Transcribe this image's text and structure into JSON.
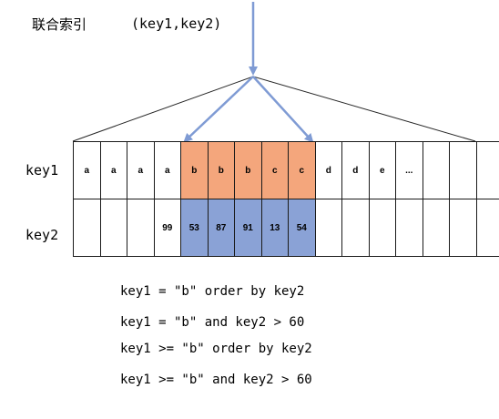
{
  "title": {
    "text": "联合索引",
    "columns": "(key1,key2)"
  },
  "rows": {
    "key1": {
      "label": "key1",
      "cells": [
        "a",
        "a",
        "a",
        "a",
        "b",
        "b",
        "b",
        "c",
        "c",
        "d",
        "d",
        "e",
        "...",
        "",
        "",
        ""
      ]
    },
    "key2": {
      "label": "key2",
      "cells": [
        "",
        "",
        "",
        "99",
        "53",
        "87",
        "91",
        "13",
        "54",
        "",
        "",
        "",
        "",
        "",
        "",
        ""
      ]
    }
  },
  "highlight": {
    "key1_color": "#f4a67c",
    "key2_color": "#8aa2d6",
    "arrow_color": "#7f9bd4",
    "columns": [
      4,
      5,
      6,
      7,
      8
    ]
  },
  "queries": [
    "key1 = \"b\" order by key2",
    "key1 = \"b\" and key2 > 60",
    "key1 >= \"b\" order by key2",
    "key1 >= \"b\" and key2 > 60"
  ]
}
